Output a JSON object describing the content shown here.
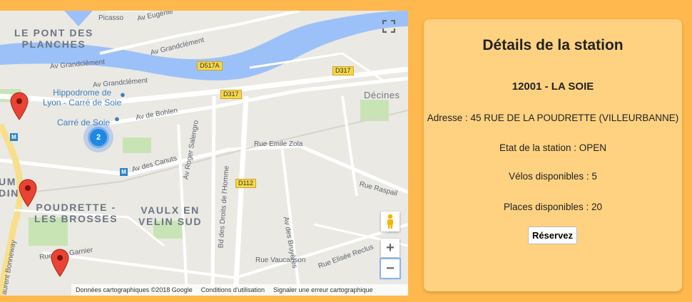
{
  "map": {
    "labels": {
      "picasso": "Picasso",
      "eugenie": "Av Eugénie",
      "grandclement1": "Av Grandclément",
      "grandclement2": "Av Grandclément",
      "grandclement3": "Av Grandclément",
      "bohlen": "Av de Bohlen",
      "canuts": "Av des Canuts",
      "salengro": "Av Roger Salengro",
      "zola": "Rue Emile Zola",
      "raspail": "Rue Raspail",
      "droits": "Bd des Droits de l'Homme",
      "bruyeres": "Av des Bruyères",
      "vaucanson": "Rue Vaucanson",
      "reclus": "Rue Elisée Reclus",
      "garnier": "Rue Gas Garnier",
      "bonneway": "aurent Bonneway"
    },
    "districts": {
      "pont": "LE PONT DES\nPLANCHES",
      "poudrette": "POUDRETTE -\nLES BROSSES",
      "vaulx": "VAULX EN\nVELIN SUD",
      "edge": "UM\nDIN",
      "decines": "Décines"
    },
    "pois": {
      "hippodrome": "Hippodrome de\nLyon - Carré de Soie",
      "carre": "Carré de Soie"
    },
    "shields": {
      "d517a": "D517A",
      "d317a": "D317",
      "d317b": "D317",
      "d112": "D112"
    },
    "cluster_count": "2",
    "metro_glyph": "M",
    "controls": {
      "zoom_in": "+",
      "zoom_out": "−"
    },
    "attribution": {
      "data": "Données cartographiques ©2018 Google",
      "terms": "Conditions d'utilisation",
      "report": "Signaler une erreur cartographique"
    },
    "colors": {
      "water": "#9cc1f8",
      "park": "#c8e4b5",
      "road": "#ffffff",
      "marker": "#ea4335",
      "cluster": "#1e88e5"
    }
  },
  "panel": {
    "title": "Détails de la station",
    "station_name": "12001 - LA SOIE",
    "address": "Adresse : 45 RUE DE LA POUDRETTE (VILLEURBANNE)",
    "status": "Etat de la station : OPEN",
    "bikes": "Vélos disponibles : 5",
    "places": "Places disponibles : 20",
    "reserve_label": "Réservez",
    "background": "#ffd281"
  }
}
